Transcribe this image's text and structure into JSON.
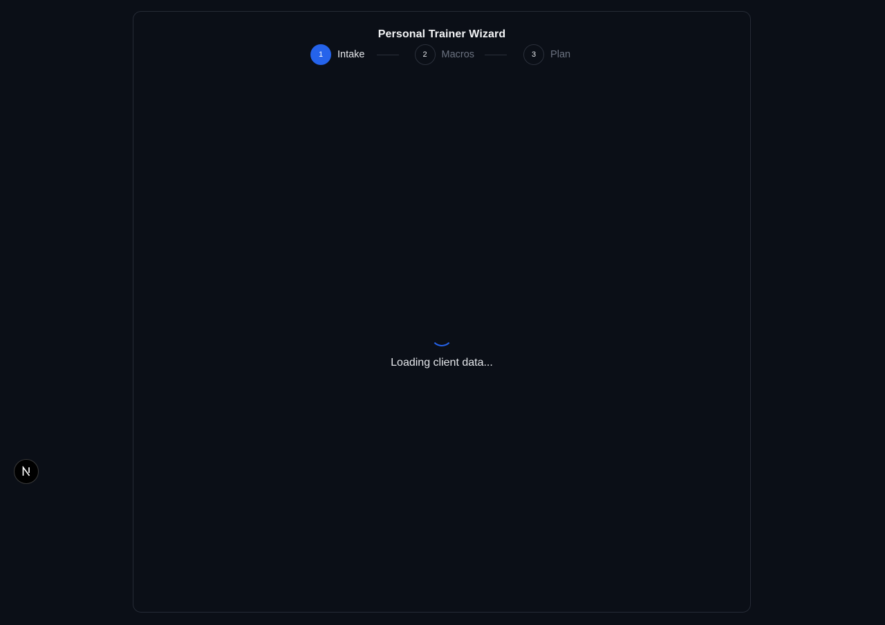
{
  "wizard": {
    "title": "Personal Trainer Wizard",
    "steps": [
      {
        "number": "1",
        "label": "Intake",
        "state": "active"
      },
      {
        "number": "2",
        "label": "Macros",
        "state": "pending"
      },
      {
        "number": "3",
        "label": "Plan",
        "state": "pending"
      }
    ]
  },
  "loading": {
    "message": "Loading client data..."
  },
  "dev_indicator": {
    "icon": "nextjs-logo-icon"
  },
  "colors": {
    "background": "#0b0f17",
    "accent": "#2563eb",
    "border": "#262b36"
  }
}
